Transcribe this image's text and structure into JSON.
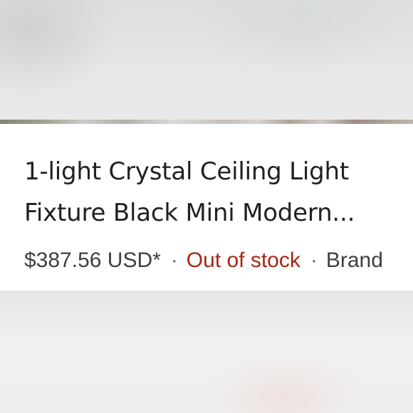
{
  "product": {
    "title_line_1": "1-light Crystal Ceiling Light",
    "title_line_2": "Fixture Black Mini Modern...",
    "price": "$387.56 USD*",
    "separator": "·",
    "stock_status": "Out of stock",
    "brand_label": "Brand"
  },
  "colors": {
    "title": "#202124",
    "meta_text": "#3c4043",
    "out_of_stock": "#a52714",
    "card_background": "#ffffff"
  }
}
